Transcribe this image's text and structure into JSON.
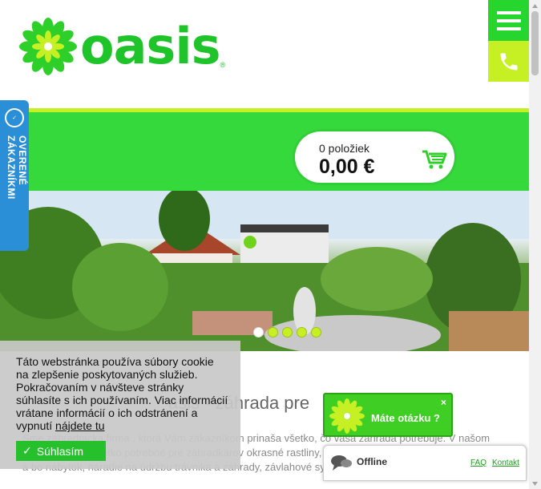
{
  "header": {
    "logo_text": "oasis",
    "logo_reg": "®",
    "menu_icon": "hamburger-menu-icon",
    "phone_icon": "phone-icon"
  },
  "colors": {
    "brand_green": "#26d52e",
    "lime": "#c6f023",
    "trust_blue": "#2a8fd6"
  },
  "cart": {
    "count_label": "0 položiek",
    "total": "0,00 €",
    "icon": "shopping-cart-icon"
  },
  "trust_widget": {
    "label": "OVERENÉ ZÁKAZNÍKMI",
    "icon": "trust-badge-icon"
  },
  "hero": {
    "slides": 5,
    "active_slide": 1
  },
  "content": {
    "heading": "asis - záhrada pre",
    "body": "Sme záhradnícka firma , ktorá Vám zákazníkom prinaša všetko, čo vaša záhrada potrebuje. V našom centre nájdete všetko potrebné pre záhradkárov okrasné rastliny, ovocné dreviny, exotické rastliny, bylinky a bo nábytok, náradie na údržbu trávnika a záhrady, závlahové systémy"
  },
  "cookie": {
    "text": "Táto webstránka používa súbory cookie na zlepšenie poskytovaných služieb. Pokračovaním v návšteve stránky súhlasíte s ich používaním. Viac informácií vrátane informácií o ich odstránení a vypnutí ",
    "link": "nájdete tu",
    "button": "Súhlasím"
  },
  "chat": {
    "prompt": "Máte otázku ?",
    "close": "×",
    "status": "Offline",
    "faq": "FAQ",
    "contact": "Kontakt"
  }
}
